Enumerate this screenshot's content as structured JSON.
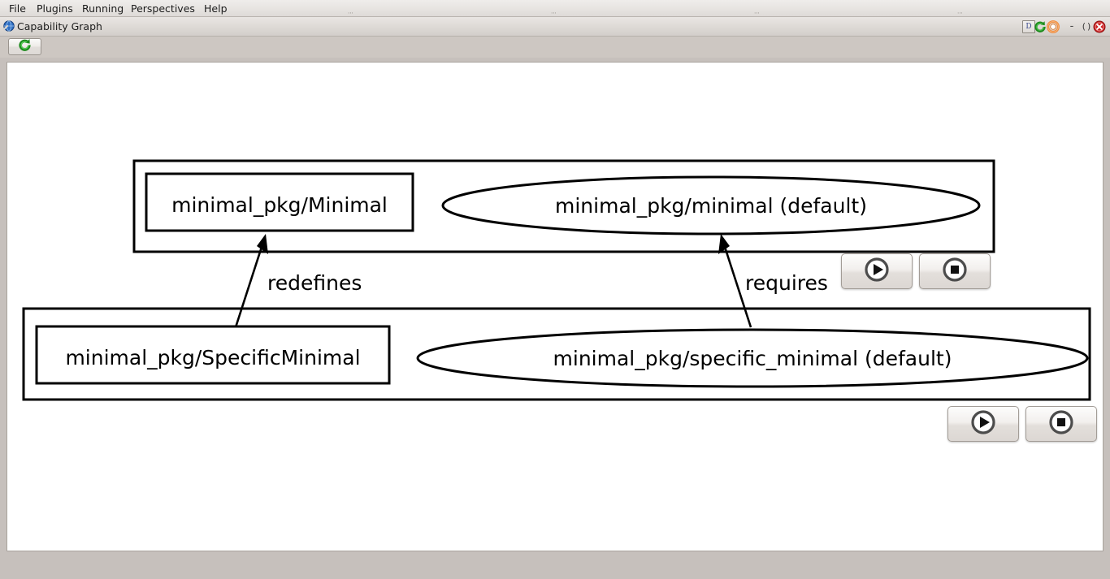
{
  "menubar": {
    "items": [
      {
        "label": "File"
      },
      {
        "label": "Plugins"
      },
      {
        "label": "Running"
      },
      {
        "label": "Perspectives"
      },
      {
        "label": "Help"
      }
    ],
    "drag_handle_glyph": "⋯"
  },
  "window": {
    "title": "Capability Graph",
    "icon": "globe-icon",
    "controls": {
      "doc_label": "D",
      "refresh": "refresh-icon",
      "help": "lifebuoy-icon",
      "minimize_label": "-",
      "maximize_label": "()",
      "close_label": "✕"
    }
  },
  "toolbar": {
    "refresh_button": {
      "name": "refresh-graph-button",
      "icon": "refresh-icon"
    }
  },
  "graph": {
    "clusters": [
      {
        "name": "cluster-minimal",
        "nodes": [
          {
            "id": "minimal-class",
            "shape": "rect",
            "label": "minimal_pkg/Minimal"
          },
          {
            "id": "minimal-default",
            "shape": "ellipse",
            "label": "minimal_pkg/minimal  (default)"
          }
        ]
      },
      {
        "name": "cluster-specific-minimal",
        "nodes": [
          {
            "id": "specific-minimal-class",
            "shape": "rect",
            "label": "minimal_pkg/SpecificMinimal"
          },
          {
            "id": "specific-minimal-default",
            "shape": "ellipse",
            "label": "minimal_pkg/specific_minimal  (default)"
          }
        ]
      }
    ],
    "edges": [
      {
        "id": "edge-redefines",
        "label": "redefines",
        "from": "specific-minimal-class",
        "to": "minimal-class"
      },
      {
        "id": "edge-requires",
        "label": "requires",
        "from": "specific-minimal-default",
        "to": "minimal-default"
      }
    ],
    "button_pairs": [
      {
        "name": "controls-minimal",
        "start": {
          "label": "play-icon"
        },
        "stop": {
          "label": "stop-icon"
        }
      },
      {
        "name": "controls-specific-minimal",
        "start": {
          "label": "play-icon"
        },
        "stop": {
          "label": "stop-icon"
        }
      }
    ]
  },
  "colors": {
    "window_bg": "#c6c0bc",
    "canvas_bg": "#ffffff",
    "graph_stroke": "#000000",
    "refresh_green": "#2e9e2e",
    "close_red": "#cc2222",
    "help_orange": "#ef8a3a"
  }
}
